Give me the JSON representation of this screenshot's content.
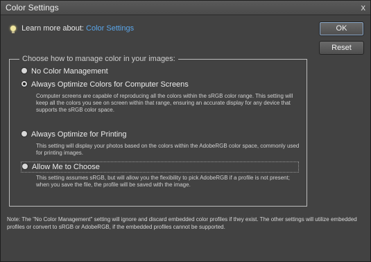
{
  "window": {
    "title": "Color Settings",
    "close_glyph": "x"
  },
  "learn_more": {
    "prefix": "Learn more about:",
    "link": "Color Settings"
  },
  "buttons": {
    "ok": "OK",
    "reset": "Reset"
  },
  "group": {
    "legend": "Choose how to manage color in your images:",
    "options": [
      {
        "label": "No Color Management",
        "selected": false,
        "description": ""
      },
      {
        "label": "Always Optimize Colors for Computer Screens",
        "selected": true,
        "description": "Computer screens are capable of reproducing all the colors within the sRGB color range. This setting will keep all the colors you see on screen within that range, ensuring an accurate display for any device that supports the sRGB color space."
      },
      {
        "label": "Always Optimize for Printing",
        "selected": false,
        "description": "This setting will display your photos based on the colors within the AdobeRGB color space, commonly used for printing images."
      },
      {
        "label": "Allow Me to Choose",
        "selected": false,
        "focused": true,
        "description": "This setting assumes sRGB, but will allow you the flexibility to pick AdobeRGB if a profile is not present; when you save the file, the profile will be saved with the image."
      }
    ]
  },
  "note": "Note: The \"No Color Management\" setting will ignore and discard embedded color profiles if they exist. The other settings will utilize embedded profiles or convert to sRGB or AdobeRGB, if the embedded profiles cannot be supported."
}
